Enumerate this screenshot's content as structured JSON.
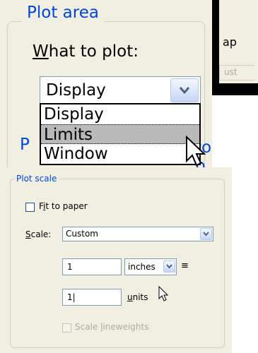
{
  "plot_area": {
    "title": "Plot area",
    "what_to_plot_label_first": "W",
    "what_to_plot_label_rest": "hat to plot:",
    "combo_value": "Display",
    "options": [
      "Display",
      "Limits",
      "Window"
    ],
    "highlighted_option": "Limits"
  },
  "background_fragments": {
    "left_letter": "P",
    "right_text": "to p",
    "top_right_text": "ap",
    "top_right_button": "ust"
  },
  "plot_scale": {
    "title": "Plot scale",
    "fit_to_paper_prefix": "F",
    "fit_to_paper_underlined": "i",
    "fit_to_paper_rest": "t to paper",
    "fit_to_paper_checked": false,
    "scale_label_underlined": "S",
    "scale_label_rest": "cale:",
    "scale_value": "Custom",
    "inches_value": "1",
    "inches_unit": "inches",
    "equals": "≡",
    "units_value": "1|",
    "units_label_underlined": "u",
    "units_label_rest": "nits",
    "scale_lineweights_prefix": "Scale ",
    "scale_lineweights_underlined": "l",
    "scale_lineweights_rest": "ineweights",
    "scale_lineweights_enabled": false
  },
  "colors": {
    "panel_bg": "#f1efe2",
    "group_title": "#0046d5",
    "highlight": "#b9b9b9",
    "disabled_text": "#acaa99"
  },
  "icons": [
    "chevron-down-icon",
    "arrow-cursor-icon"
  ]
}
